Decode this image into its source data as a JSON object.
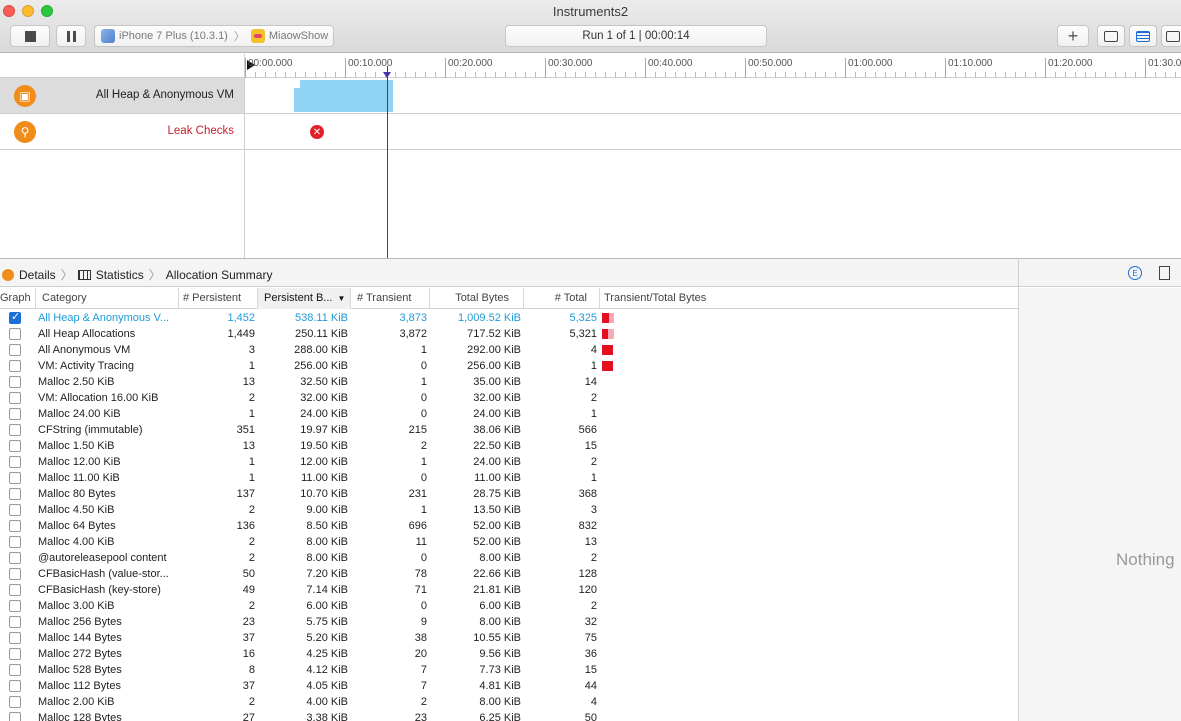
{
  "window": {
    "title": "Instruments2"
  },
  "toolbar": {
    "device": "iPhone 7 Plus (10.3.1)",
    "app": "MiaowShow",
    "run_status": "Run 1 of 1  |  00:00:14",
    "add_label": "+"
  },
  "timeline": {
    "ticks": [
      "00:00.000",
      "00:10.000",
      "00:20.000",
      "00:30.000",
      "00:40.000",
      "00:50.000",
      "01:00.000",
      "01:10.000",
      "01:20.000",
      "01:30.0"
    ],
    "tracks": [
      {
        "name": "All Heap & Anonymous VM"
      },
      {
        "name": "Leak Checks"
      }
    ]
  },
  "jumpbar": {
    "crumb1": "Details",
    "crumb2": "Statistics",
    "crumb3": "Allocation Summary"
  },
  "inspector": {
    "placeholder": "Nothing"
  },
  "table": {
    "headers": {
      "graph": "Graph",
      "category": "Category",
      "persistent": "# Persistent",
      "persistent_bytes": "Persistent B...",
      "transient": "# Transient",
      "total_bytes": "Total Bytes",
      "total": "# Total",
      "transient_total": "Transient/Total Bytes"
    },
    "rows": [
      {
        "checked": true,
        "category": "All Heap & Anonymous V...",
        "persistent": "1,452",
        "persistent_bytes": "538.11 KiB",
        "transient": "3,873",
        "total_bytes": "1,009.52 KiB",
        "total": "5,325",
        "ratio": 0.53,
        "trans": 0.47
      },
      {
        "checked": false,
        "category": "All Heap Allocations",
        "persistent": "1,449",
        "persistent_bytes": "250.11 KiB",
        "transient": "3,872",
        "total_bytes": "717.52 KiB",
        "total": "5,321",
        "ratio": 0.35,
        "trans": 0.65
      },
      {
        "checked": false,
        "category": "All Anonymous VM",
        "persistent": "3",
        "persistent_bytes": "288.00 KiB",
        "transient": "1",
        "total_bytes": "292.00 KiB",
        "total": "4",
        "ratio": 0.99,
        "trans": 0.01
      },
      {
        "checked": false,
        "category": "VM: Activity Tracing",
        "persistent": "1",
        "persistent_bytes": "256.00 KiB",
        "transient": "0",
        "total_bytes": "256.00 KiB",
        "total": "1",
        "ratio": 1.0,
        "trans": 0.0
      },
      {
        "checked": false,
        "category": "Malloc 2.50 KiB",
        "persistent": "13",
        "persistent_bytes": "32.50 KiB",
        "transient": "1",
        "total_bytes": "35.00 KiB",
        "total": "14"
      },
      {
        "checked": false,
        "category": "VM: Allocation 16.00 KiB",
        "persistent": "2",
        "persistent_bytes": "32.00 KiB",
        "transient": "0",
        "total_bytes": "32.00 KiB",
        "total": "2"
      },
      {
        "checked": false,
        "category": "Malloc 24.00 KiB",
        "persistent": "1",
        "persistent_bytes": "24.00 KiB",
        "transient": "0",
        "total_bytes": "24.00 KiB",
        "total": "1"
      },
      {
        "checked": false,
        "category": "CFString (immutable)",
        "persistent": "351",
        "persistent_bytes": "19.97 KiB",
        "transient": "215",
        "total_bytes": "38.06 KiB",
        "total": "566"
      },
      {
        "checked": false,
        "category": "Malloc 1.50 KiB",
        "persistent": "13",
        "persistent_bytes": "19.50 KiB",
        "transient": "2",
        "total_bytes": "22.50 KiB",
        "total": "15"
      },
      {
        "checked": false,
        "category": "Malloc 12.00 KiB",
        "persistent": "1",
        "persistent_bytes": "12.00 KiB",
        "transient": "1",
        "total_bytes": "24.00 KiB",
        "total": "2"
      },
      {
        "checked": false,
        "category": "Malloc 11.00 KiB",
        "persistent": "1",
        "persistent_bytes": "11.00 KiB",
        "transient": "0",
        "total_bytes": "11.00 KiB",
        "total": "1"
      },
      {
        "checked": false,
        "category": "Malloc 80 Bytes",
        "persistent": "137",
        "persistent_bytes": "10.70 KiB",
        "transient": "231",
        "total_bytes": "28.75 KiB",
        "total": "368"
      },
      {
        "checked": false,
        "category": "Malloc 4.50 KiB",
        "persistent": "2",
        "persistent_bytes": "9.00 KiB",
        "transient": "1",
        "total_bytes": "13.50 KiB",
        "total": "3"
      },
      {
        "checked": false,
        "category": "Malloc 64 Bytes",
        "persistent": "136",
        "persistent_bytes": "8.50 KiB",
        "transient": "696",
        "total_bytes": "52.00 KiB",
        "total": "832"
      },
      {
        "checked": false,
        "category": "Malloc 4.00 KiB",
        "persistent": "2",
        "persistent_bytes": "8.00 KiB",
        "transient": "11",
        "total_bytes": "52.00 KiB",
        "total": "13"
      },
      {
        "checked": false,
        "category": "@autoreleasepool content",
        "persistent": "2",
        "persistent_bytes": "8.00 KiB",
        "transient": "0",
        "total_bytes": "8.00 KiB",
        "total": "2"
      },
      {
        "checked": false,
        "category": "CFBasicHash (value-stor...",
        "persistent": "50",
        "persistent_bytes": "7.20 KiB",
        "transient": "78",
        "total_bytes": "22.66 KiB",
        "total": "128"
      },
      {
        "checked": false,
        "category": "CFBasicHash (key-store)",
        "persistent": "49",
        "persistent_bytes": "7.14 KiB",
        "transient": "71",
        "total_bytes": "21.81 KiB",
        "total": "120"
      },
      {
        "checked": false,
        "category": "Malloc 3.00 KiB",
        "persistent": "2",
        "persistent_bytes": "6.00 KiB",
        "transient": "0",
        "total_bytes": "6.00 KiB",
        "total": "2"
      },
      {
        "checked": false,
        "category": "Malloc 256 Bytes",
        "persistent": "23",
        "persistent_bytes": "5.75 KiB",
        "transient": "9",
        "total_bytes": "8.00 KiB",
        "total": "32"
      },
      {
        "checked": false,
        "category": "Malloc 144 Bytes",
        "persistent": "37",
        "persistent_bytes": "5.20 KiB",
        "transient": "38",
        "total_bytes": "10.55 KiB",
        "total": "75"
      },
      {
        "checked": false,
        "category": "Malloc 272 Bytes",
        "persistent": "16",
        "persistent_bytes": "4.25 KiB",
        "transient": "20",
        "total_bytes": "9.56 KiB",
        "total": "36"
      },
      {
        "checked": false,
        "category": "Malloc 528 Bytes",
        "persistent": "8",
        "persistent_bytes": "4.12 KiB",
        "transient": "7",
        "total_bytes": "7.73 KiB",
        "total": "15"
      },
      {
        "checked": false,
        "category": "Malloc 112 Bytes",
        "persistent": "37",
        "persistent_bytes": "4.05 KiB",
        "transient": "7",
        "total_bytes": "4.81 KiB",
        "total": "44"
      },
      {
        "checked": false,
        "category": "Malloc 2.00 KiB",
        "persistent": "2",
        "persistent_bytes": "4.00 KiB",
        "transient": "2",
        "total_bytes": "8.00 KiB",
        "total": "4"
      },
      {
        "checked": false,
        "category": "Malloc 128 Bytes",
        "persistent": "27",
        "persistent_bytes": "3.38 KiB",
        "transient": "23",
        "total_bytes": "6.25 KiB",
        "total": "50"
      }
    ]
  }
}
